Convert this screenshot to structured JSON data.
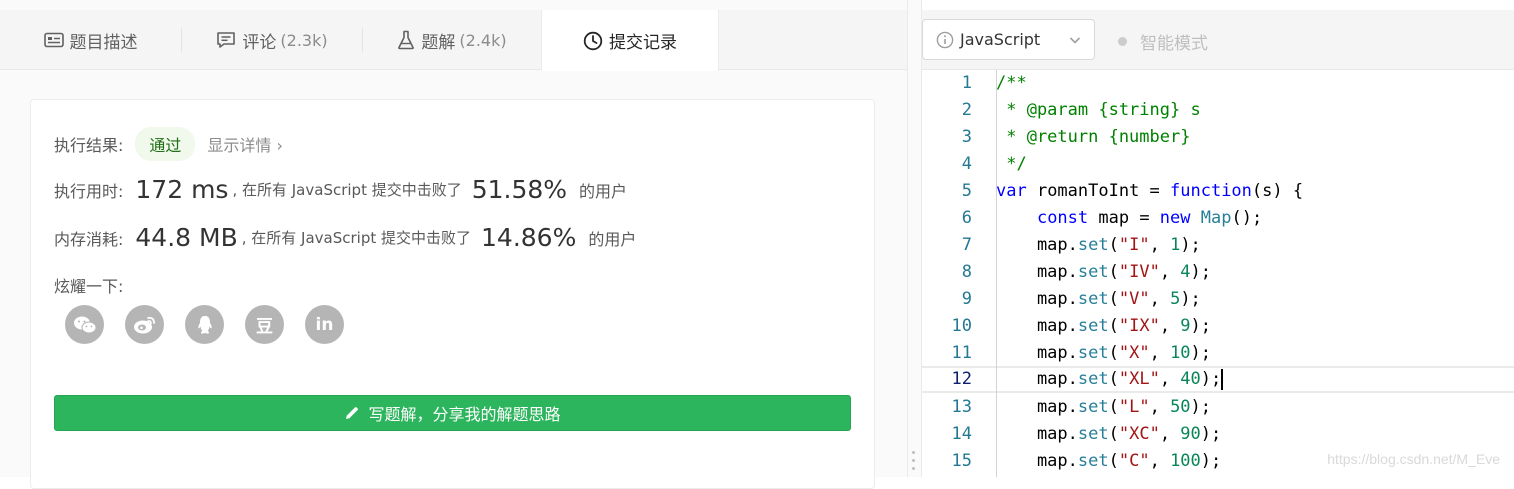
{
  "tabs": [
    {
      "label": "题目描述",
      "count": "",
      "icon": "description-icon"
    },
    {
      "label": "评论",
      "count": "(2.3k)",
      "icon": "comment-icon"
    },
    {
      "label": "题解",
      "count": "(2.4k)",
      "icon": "flask-icon"
    },
    {
      "label": "提交记录",
      "count": "",
      "icon": "clock-icon",
      "active": true
    }
  ],
  "result": {
    "label": "执行结果:",
    "status": "通过",
    "detail_link": "显示详情 ›",
    "status_color": "#1f6d14"
  },
  "runtime": {
    "label": "执行用时:",
    "value": "172 ms",
    "desc": ", 在所有 JavaScript 提交中击败了",
    "percent": "51.58%",
    "suffix": "的用户"
  },
  "memory": {
    "label": "内存消耗:",
    "value": "44.8 MB",
    "desc": ", 在所有 JavaScript 提交中击败了",
    "percent": "14.86%",
    "suffix": "的用户"
  },
  "share": {
    "label": "炫耀一下:",
    "icons": [
      "wechat-icon",
      "weibo-icon",
      "qq-icon",
      "douban-icon",
      "linkedin-icon"
    ],
    "douban_text": "豆",
    "linkedin_text": "in"
  },
  "write_button": {
    "label": "写题解，分享我的解题思路",
    "color": "#2db55d"
  },
  "editor": {
    "language": "JavaScript",
    "smart_mode": "智能模式",
    "current_line": 12,
    "lines": [
      {
        "n": "1",
        "text": "/**"
      },
      {
        "n": "2",
        "text": " * @param {string} s"
      },
      {
        "n": "3",
        "text": " * @return {number}"
      },
      {
        "n": "4",
        "text": " */"
      },
      {
        "n": "5",
        "text": "var romanToInt = function(s) {"
      },
      {
        "n": "6",
        "text": "    const map = new Map();"
      },
      {
        "n": "7",
        "text": "    map.set(\"I\", 1);"
      },
      {
        "n": "8",
        "text": "    map.set(\"IV\", 4);"
      },
      {
        "n": "9",
        "text": "    map.set(\"V\", 5);"
      },
      {
        "n": "10",
        "text": "    map.set(\"IX\", 9);"
      },
      {
        "n": "11",
        "text": "    map.set(\"X\", 10);"
      },
      {
        "n": "12",
        "text": "    map.set(\"XL\", 40);"
      },
      {
        "n": "13",
        "text": "    map.set(\"L\", 50);"
      },
      {
        "n": "14",
        "text": "    map.set(\"XC\", 90);"
      },
      {
        "n": "15",
        "text": "    map.set(\"C\", 100);"
      }
    ]
  },
  "watermark": "https://blog.csdn.net/M_Eve"
}
